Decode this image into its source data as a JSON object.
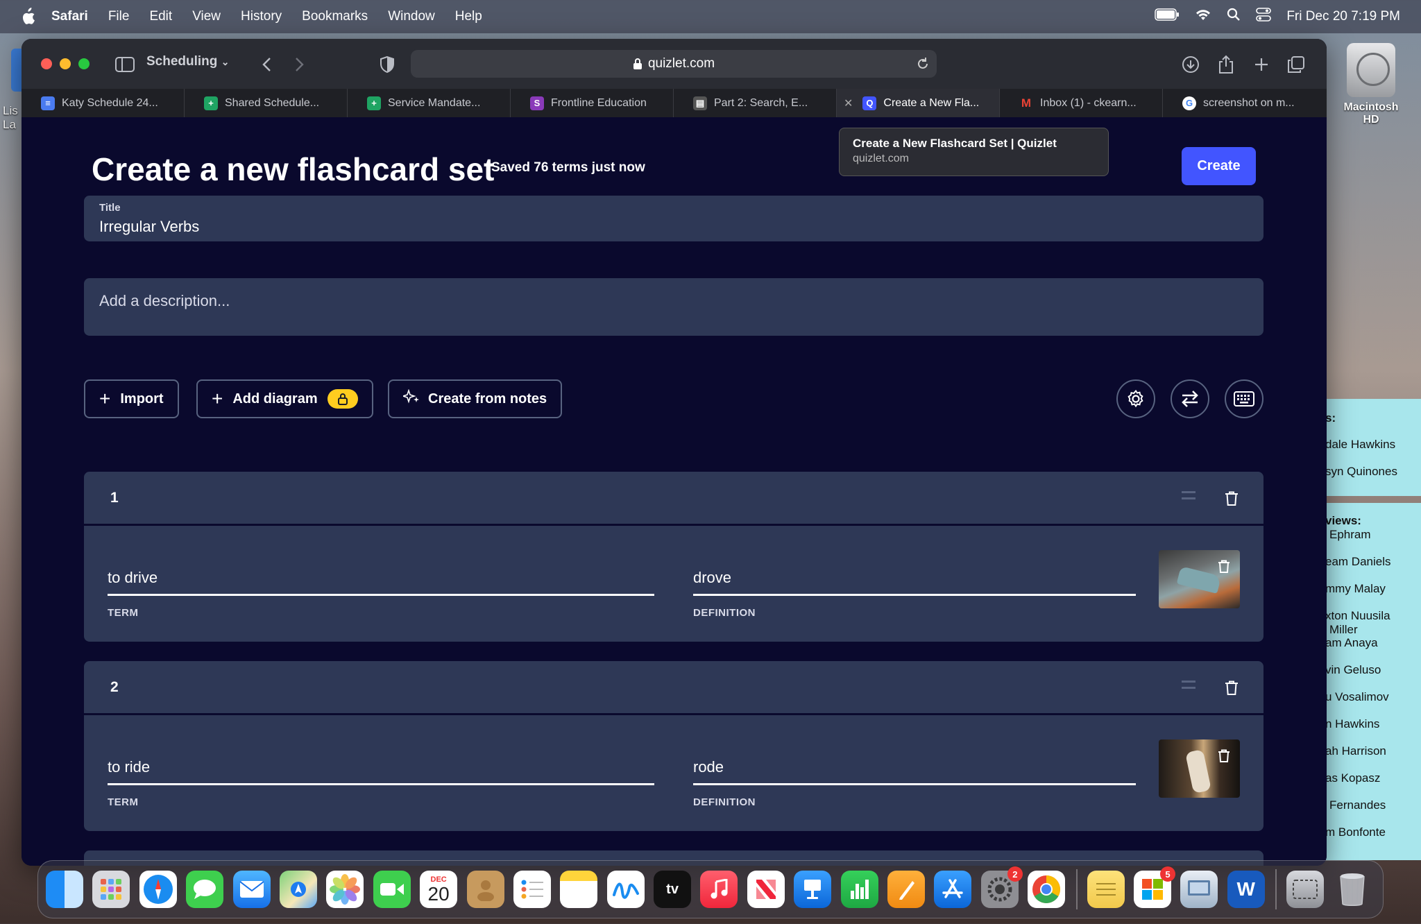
{
  "menubar": {
    "app": "Safari",
    "items": [
      "File",
      "Edit",
      "View",
      "History",
      "Bookmarks",
      "Window",
      "Help"
    ],
    "clock": "Fri Dec 20  7:19 PM"
  },
  "desktop": {
    "hd_label": "Macintosh HD",
    "left_label": "Lis\nLa",
    "sticky_top": [
      "s:",
      "dale Hawkins",
      "syn Quinones"
    ],
    "sticky_bottom": [
      "views:",
      "Ephram",
      "eam Daniels",
      "mmy Malay",
      "xton Nuusila",
      "Miller",
      "am Anaya",
      "vin Geluso",
      "u Vosalimov",
      "n Hawkins",
      "ah Harrison",
      "as Kopasz",
      "Fernandes",
      "m Bonfonte"
    ]
  },
  "browser": {
    "tab_group": "Scheduling",
    "url": "quizlet.com",
    "tabs": [
      {
        "label": "Katy Schedule 24...",
        "color": "#4a7bf0",
        "glyph": "≡"
      },
      {
        "label": "Shared Schedule...",
        "color": "#1fa463",
        "glyph": "+"
      },
      {
        "label": "Service Mandate...",
        "color": "#1fa463",
        "glyph": "+"
      },
      {
        "label": "Frontline Education",
        "color": "#8a3ab9",
        "glyph": "S"
      },
      {
        "label": "Part 2: Search, E...",
        "color": "#555",
        "glyph": "▤"
      },
      {
        "label": "Create a New Fla...",
        "color": "#4255ff",
        "glyph": "Q"
      },
      {
        "label": "Inbox (1) - ckearn...",
        "color": "#ea4335",
        "glyph": "M"
      },
      {
        "label": "screenshot on m...",
        "color": "#4285f4",
        "glyph": "G"
      }
    ],
    "tooltip_title": "Create a New Flashcard Set | Quizlet",
    "tooltip_url": "quizlet.com"
  },
  "page": {
    "heading": "Create a new flashcard set",
    "saved_status": "Saved 76 terms just now",
    "create_label": "Create",
    "title_label": "Title",
    "title_value": "Irregular Verbs",
    "description_placeholder": "Add a description...",
    "import_label": "Import",
    "add_diagram_label": "Add diagram",
    "create_from_notes_label": "Create from notes",
    "cards": [
      {
        "num": "1",
        "term": "to drive",
        "term_label": "TERM",
        "definition": "drove",
        "definition_label": "DEFINITION"
      },
      {
        "num": "2",
        "term": "to ride",
        "term_label": "TERM",
        "definition": "rode",
        "definition_label": "DEFINITION"
      }
    ]
  },
  "dock": {
    "icons": [
      "finder-icon",
      "launchpad-icon",
      "safari-icon",
      "messages-icon",
      "mail-icon",
      "maps-icon",
      "photos-icon",
      "facetime-icon",
      "calendar-icon",
      "contacts-icon",
      "reminders-icon",
      "notes-icon",
      "freeform-icon",
      "tv-icon",
      "music-icon",
      "news-icon",
      "keynote-icon",
      "numbers-icon",
      "pages-icon",
      "app-store-icon",
      "system-settings-icon",
      "chrome-icon",
      "stickies-icon",
      "microsoft-store-icon",
      "preview-icon",
      "word-icon",
      "screenshot-icon",
      "trash-icon"
    ],
    "calendar_month": "DEC",
    "calendar_day": "20",
    "tv_label": "tv",
    "settings_badge": "2",
    "store_badge": "5"
  }
}
